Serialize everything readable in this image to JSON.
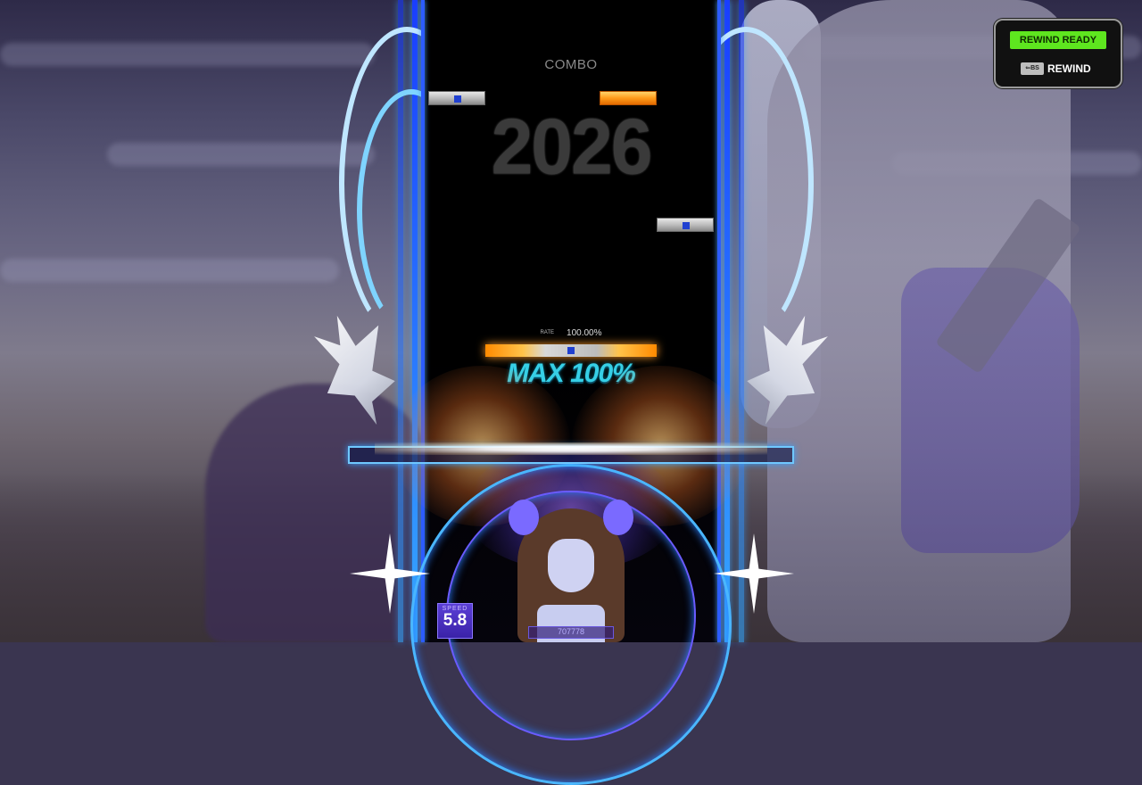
{
  "hud": {
    "combo_label": "COMBO",
    "combo_value": "2026",
    "rate_label": "RATE",
    "rate_value": "100.00%",
    "judgement": "MAX 100%",
    "speed_label": "SPEED",
    "speed_value": "5.8",
    "score": "707778"
  },
  "rewind": {
    "status": "REWIND READY",
    "key": "⇐BS",
    "action_label": "REWIND"
  },
  "colors": {
    "rewind_ready_bg": "#5ee61f",
    "judgement_text": "#36cfe6",
    "lane_edge": "#2c5cff",
    "note_orange": "#ff9b1a"
  }
}
